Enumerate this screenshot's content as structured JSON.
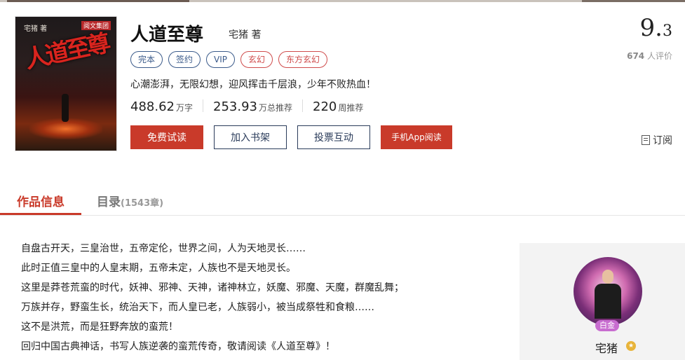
{
  "book": {
    "title": "人道至尊",
    "author": "宅猪 著",
    "cover": {
      "author_text": "宅猪 著",
      "publisher_text": "阅文集团",
      "title_text": "人道至尊"
    },
    "tags": [
      {
        "label": "完本",
        "color": "#3a5a8a"
      },
      {
        "label": "签约",
        "color": "#3a5a8a"
      },
      {
        "label": "VIP",
        "color": "#3a5a8a"
      },
      {
        "label": "玄幻",
        "color": "#cf4b4b"
      },
      {
        "label": "东方玄幻",
        "color": "#cf4b4b"
      }
    ],
    "intro": "心潮澎湃，无限幻想，迎风挥击千层浪，少年不败热血！",
    "stats": [
      {
        "num": "488.62",
        "unit": "万字"
      },
      {
        "num": "253.93",
        "unit": "万总推荐"
      },
      {
        "num": "220",
        "unit": "周推荐"
      }
    ],
    "score_int": "9.",
    "score_dec": "3",
    "raters_count": "674",
    "raters_label": " 人评价"
  },
  "actions": {
    "free_read": "免费试读",
    "add_shelf": "加入书架",
    "vote": "投票互动",
    "app_read": "手机App阅读",
    "subscribe": "订阅"
  },
  "tabs": {
    "info": "作品信息",
    "catalog": "目录",
    "catalog_count": "(1543章)"
  },
  "description": [
    "自盘古开天，三皇治世，五帝定伦，世界之间，人为天地灵长……",
    "此时正值三皇中的人皇末期，五帝未定，人族也不是天地灵长。",
    "这里是莽苍荒蛮的时代，妖神、邪神、天神，诸神林立，妖魔、邪魔、天魔，群魔乱舞；",
    "万族并存，野蛮生长，统治天下，而人皇已老，人族弱小，被当成祭牲和食粮……",
    "这不是洪荒，而是狂野奔放的蛮荒！",
    "回归中国古典神话，书写人族逆袭的蛮荒传奇，敬请阅读《人道至尊》！"
  ],
  "author_card": {
    "level": "白金",
    "name": "宅猪",
    "medal": "★"
  },
  "colors": {
    "accent": "#c93a2a",
    "navy": "#2a3b5a"
  }
}
